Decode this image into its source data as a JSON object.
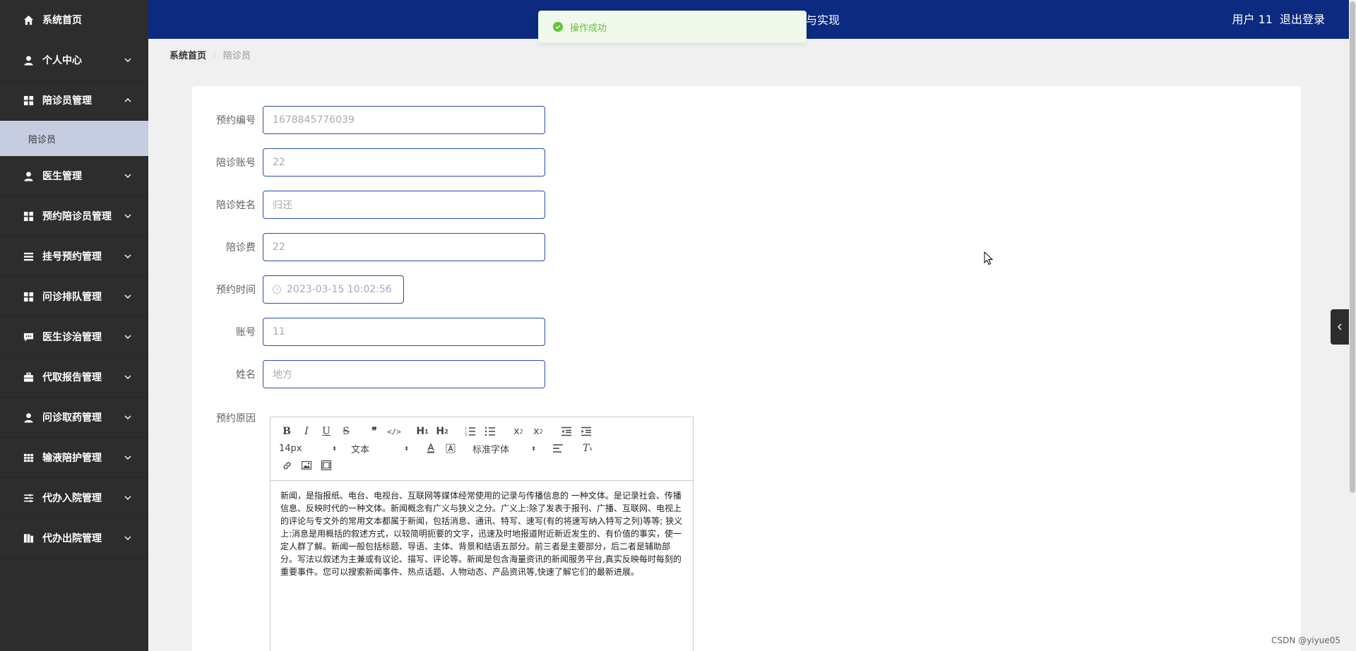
{
  "sidebar": {
    "items": [
      {
        "label": "系统首页",
        "icon": "home-icon",
        "has_chevron": false
      },
      {
        "label": "个人中心",
        "icon": "user-icon",
        "has_chevron": true
      },
      {
        "label": "陪诊员管理",
        "icon": "grid-icon",
        "has_chevron": true,
        "expanded": true
      },
      {
        "label": "医生管理",
        "icon": "user-icon",
        "has_chevron": true
      },
      {
        "label": "预约陪诊员管理",
        "icon": "grid-icon",
        "has_chevron": true
      },
      {
        "label": "挂号预约管理",
        "icon": "list-icon",
        "has_chevron": true
      },
      {
        "label": "问诊排队管理",
        "icon": "grid-icon",
        "has_chevron": true
      },
      {
        "label": "医生诊治管理",
        "icon": "chat-icon",
        "has_chevron": true
      },
      {
        "label": "代取报告管理",
        "icon": "briefcase-icon",
        "has_chevron": true
      },
      {
        "label": "问诊取药管理",
        "icon": "user-icon",
        "has_chevron": true
      },
      {
        "label": "输液陪护管理",
        "icon": "table-icon",
        "has_chevron": true
      },
      {
        "label": "代办入院管理",
        "icon": "sliders-icon",
        "has_chevron": true
      },
      {
        "label": "代办出院管理",
        "icon": "columns-icon",
        "has_chevron": true
      }
    ],
    "sub_item": "陪诊员"
  },
  "header": {
    "title": "计与实现",
    "user": "用户 11",
    "logout": "退出登录"
  },
  "toast": {
    "message": "操作成功"
  },
  "breadcrumb": {
    "home": "系统首页",
    "current": "陪诊员"
  },
  "form": {
    "booking_no": {
      "label": "预约编号",
      "placeholder": "1678845776039"
    },
    "escort_account": {
      "label": "陪诊账号",
      "placeholder": "22"
    },
    "escort_name": {
      "label": "陪诊姓名",
      "placeholder": "归还"
    },
    "fee": {
      "label": "陪诊费",
      "placeholder": "22"
    },
    "booking_time": {
      "label": "预约时间",
      "placeholder": "2023-03-15 10:02:56"
    },
    "account": {
      "label": "账号",
      "placeholder": "11"
    },
    "name": {
      "label": "姓名",
      "placeholder": "地方"
    },
    "reason": {
      "label": "预约原因"
    }
  },
  "editor": {
    "font_size": "14px",
    "block_type": "文本",
    "font_family": "标准字体",
    "content": "新闻，是指报纸、电台、电视台、互联网等媒体经常使用的记录与传播信息的 一种文体。是记录社会、传播信息、反映时代的一种文体。新闻概念有广义与狭义之分。广义上:除了发表于报刊、广播、互联网、电视上的评论与专文外的常用文本都属于新闻，包括消息、通讯、特写、速写(有的将速写纳入特写之列)等等; 狭义上:消息是用概括的叙述方式，以较简明扼要的文字，迅速及时地报道附近新近发生的、有价值的事实，使一定人群了解。新闻一般包括标题、导语、主体、背景和结语五部分。前三者是主要部分，后二者是辅助部分。写法以叙述为主兼或有议论、描写、评论等。新闻是包含海量资讯的新闻服务平台,真实反映每时每刻的重要事件。您可以搜索新闻事件、热点话题、人物动态、产品资讯等,快速了解它们的最新进展。"
  },
  "watermark": "CSDN @yiyue05",
  "colors": {
    "header_bg": "#0b2a80",
    "sidebar_bg": "#2d2d2d",
    "active_sub_bg": "#c6cde1",
    "success": "#67c23a"
  }
}
